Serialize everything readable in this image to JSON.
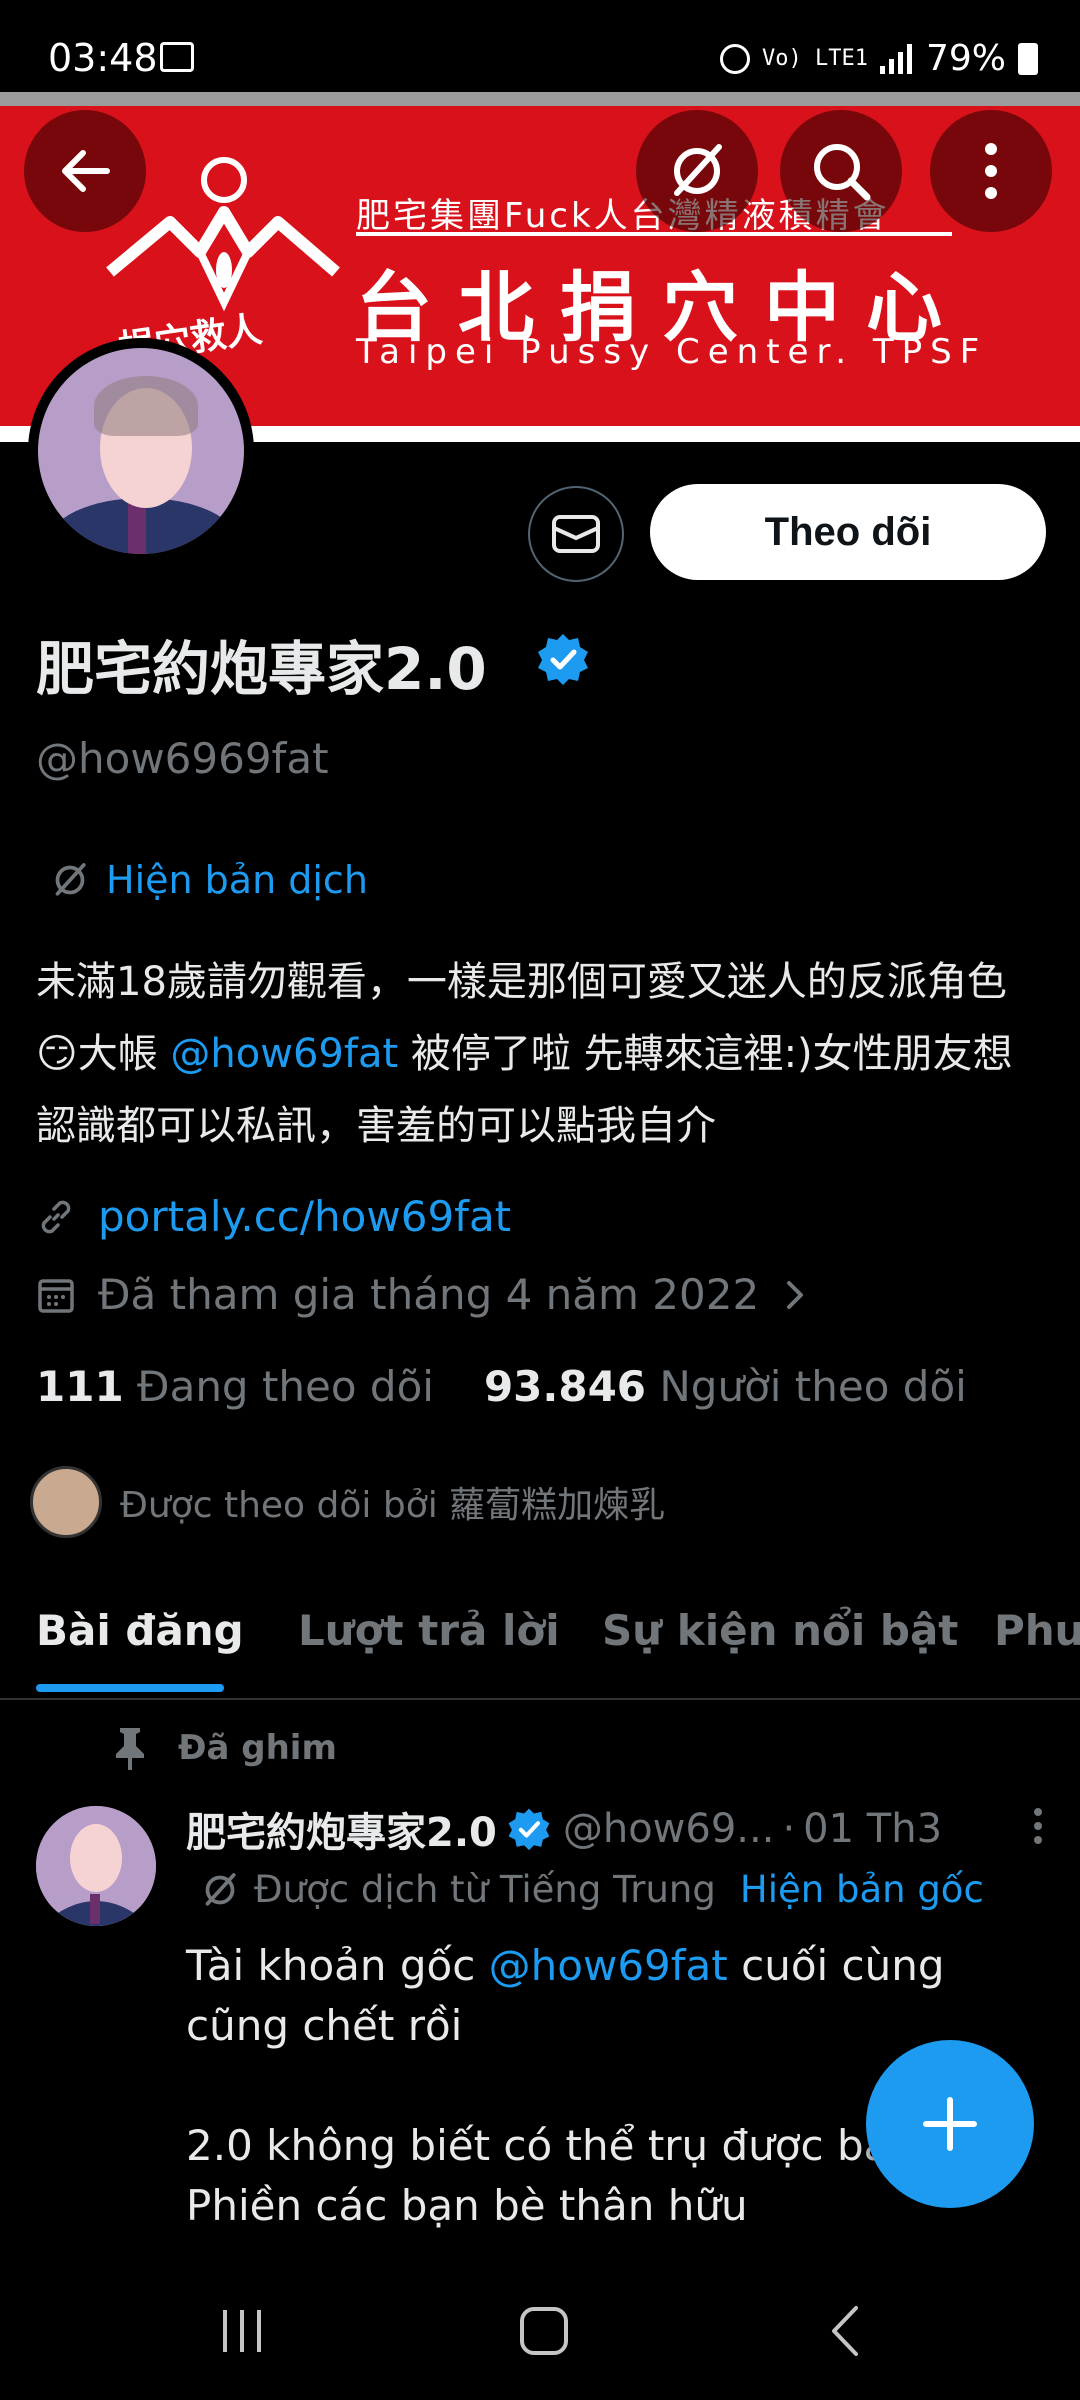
{
  "status_bar": {
    "time": "03:48",
    "battery": "79%",
    "network": "Vo) LTE1"
  },
  "banner": {
    "line1": "肥宅集團Fuck人台灣精液積精會",
    "line2": "台北捐穴中心",
    "line3": "Taipei  Pussy  Center.  TPSF",
    "tag": "捐穴救人"
  },
  "header": {
    "back_icon": "arrow-left-icon",
    "translate_icon": "translate-icon",
    "search_icon": "search-icon",
    "more_icon": "more-vertical-icon"
  },
  "profile": {
    "display_name": "肥宅約炮專家2.0",
    "handle": "@how6969fat",
    "follow_label": "Theo dõi",
    "translate_label": "Hiện bản dịch",
    "bio_part1": "未滿18歲請勿觀看，一樣是那個可愛又迷人的反派角色",
    "bio_emoji": "😏",
    "bio_part2": "大帳 ",
    "bio_mention": "@how69fat",
    "bio_part3": " 被停了啦 先轉來這裡:)女性朋友想認識都可以私訊，害羞的可以點我自介",
    "link": "portaly.cc/how69fat",
    "joined": "Đã tham gia tháng 4 năm 2022",
    "following_count": "111",
    "following_label": "Đang theo dõi",
    "followers_count": "93.846",
    "followers_label": "Người theo dõi",
    "followed_by": "Được theo dõi bởi 蘿蔔糕加煉乳"
  },
  "tabs": [
    {
      "label": "Bài đăng"
    },
    {
      "label": "Lượt trả lời"
    },
    {
      "label": "Sự kiện nổi bật"
    },
    {
      "label": "Phư"
    }
  ],
  "post": {
    "pinned_label": "Đã ghim",
    "name": "肥宅約炮專家2.0",
    "handle": "@how69...",
    "dot": "·",
    "time": "01 Th3",
    "translated_label": "Được dịch từ Tiếng Trung",
    "show_original": "Hiện bản gốc",
    "text_part1": "Tài khoản gốc ",
    "text_mention": "@how69fat",
    "text_part2": " cuối cùng cũng chết rồi",
    "text_line2": "2.0 không biết có thể trụ được bao",
    "text_line3": "Phiền các bạn bè thân hữu"
  },
  "colors": {
    "accent": "#1d9bf0",
    "banner_red": "#d8111a",
    "muted": "#71767b"
  }
}
